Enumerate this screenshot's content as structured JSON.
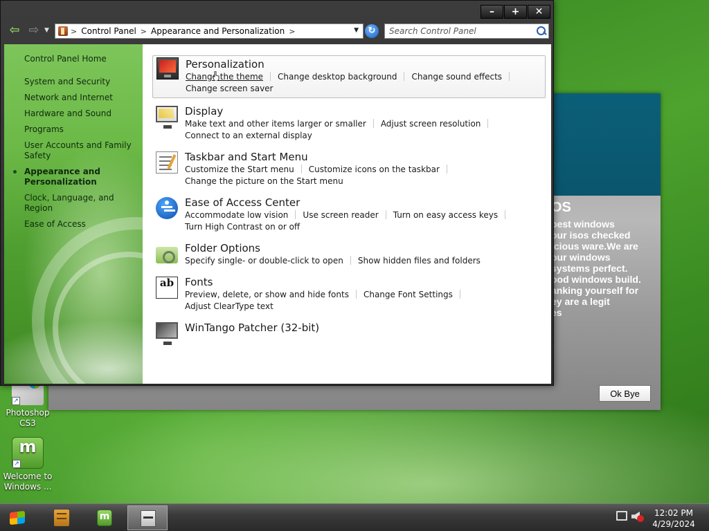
{
  "background_dialog": {
    "heading": "OS",
    "message": "best windows\nour isos checked\nicious ware.We are\nour windows\nsystems perfect.\nood windows build.\nanking yourself for\ney are a legit\nes",
    "ok_label": "Ok Bye"
  },
  "desktop_icons": [
    {
      "label": "Photoshop CS3"
    },
    {
      "label": "Welcome to Windows ..."
    }
  ],
  "window": {
    "controls": {
      "minimize": "–",
      "maximize": "+",
      "close": "✕"
    },
    "address": {
      "crumbs": [
        "Control Panel",
        "Appearance and Personalization"
      ],
      "separator": ">"
    },
    "search_placeholder": "Search Control Panel",
    "sidebar": {
      "home": "Control Panel Home",
      "items": [
        {
          "label": "System and Security"
        },
        {
          "label": "Network and Internet"
        },
        {
          "label": "Hardware and Sound"
        },
        {
          "label": "Programs"
        },
        {
          "label": "User Accounts and Family Safety"
        },
        {
          "label": "Appearance and Personalization"
        },
        {
          "label": "Clock, Language, and Region"
        },
        {
          "label": "Ease of Access"
        }
      ]
    },
    "categories": [
      {
        "title": "Personalization",
        "icon": "personalization-icon",
        "links": [
          "Change the theme",
          "Change desktop background",
          "Change sound effects",
          "Change screen saver"
        ]
      },
      {
        "title": "Display",
        "icon": "display-icon",
        "links": [
          "Make text and other items larger or smaller",
          "Adjust screen resolution",
          "Connect to an external display"
        ]
      },
      {
        "title": "Taskbar and Start Menu",
        "icon": "taskbar-icon",
        "links": [
          "Customize the Start menu",
          "Customize icons on the taskbar",
          "Change the picture on the Start menu"
        ]
      },
      {
        "title": "Ease of Access Center",
        "icon": "ease-of-access-icon",
        "links": [
          "Accommodate low vision",
          "Use screen reader",
          "Turn on easy access keys",
          "Turn High Contrast on or off"
        ]
      },
      {
        "title": "Folder Options",
        "icon": "folder-options-icon",
        "links": [
          "Specify single- or double-click to open",
          "Show hidden files and folders"
        ]
      },
      {
        "title": "Fonts",
        "icon": "fonts-icon",
        "links": [
          "Preview, delete, or show and hide fonts",
          "Change Font Settings",
          "Adjust ClearType text"
        ]
      },
      {
        "title": "WinTango Patcher (32-bit)",
        "icon": "wintango-icon",
        "links": []
      }
    ],
    "fonts_icon_glyph": "ab"
  },
  "taskbar": {
    "clock_time": "12:02 PM",
    "clock_date": "4/29/2024"
  }
}
